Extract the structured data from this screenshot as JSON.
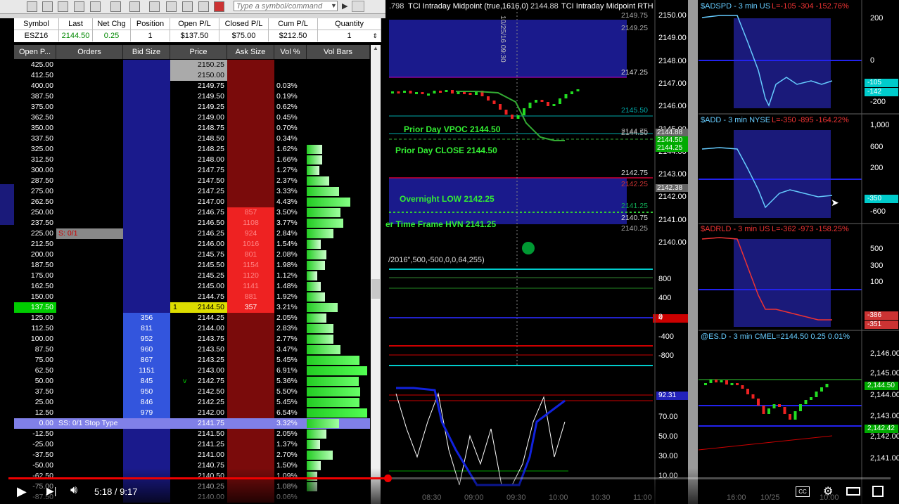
{
  "toolbar": {
    "symbol_placeholder": "Type a symbol/command"
  },
  "info": {
    "headers": [
      "Symbol",
      "Last",
      "Net Chg",
      "Position",
      "Open P/L",
      "Closed P/L",
      "Cum P/L",
      "Quantity"
    ],
    "values": [
      "ESZ16",
      "2144.50",
      "0.25",
      "1",
      "$137.50",
      "$75.00",
      "$212.50",
      "1"
    ]
  },
  "ladder": {
    "headers": [
      "Open P...",
      "Orders",
      "Bid Size",
      "Price",
      "Ask Size",
      "Vol %",
      "Vol Bars"
    ],
    "rows": [
      {
        "pl": "425.00",
        "ord": "",
        "bid": "",
        "price": "2150.25",
        "ask": "",
        "vol": "",
        "vb": 0
      },
      {
        "pl": "412.50",
        "ord": "",
        "bid": "",
        "price": "2150.00",
        "ask": "",
        "vol": "",
        "vb": 0
      },
      {
        "pl": "400.00",
        "ord": "",
        "bid": "",
        "price": "2149.75",
        "ask": "",
        "vol": "0.03%",
        "vb": 0
      },
      {
        "pl": "387.50",
        "ord": "",
        "bid": "",
        "price": "2149.50",
        "ask": "",
        "vol": "0.19%",
        "vb": 0
      },
      {
        "pl": "375.00",
        "ord": "",
        "bid": "",
        "price": "2149.25",
        "ask": "",
        "vol": "0.62%",
        "vb": 0
      },
      {
        "pl": "362.50",
        "ord": "",
        "bid": "",
        "price": "2149.00",
        "ask": "",
        "vol": "0.45%",
        "vb": 0
      },
      {
        "pl": "350.00",
        "ord": "",
        "bid": "",
        "price": "2148.75",
        "ask": "",
        "vol": "0.70%",
        "vb": 0
      },
      {
        "pl": "337.50",
        "ord": "",
        "bid": "",
        "price": "2148.50",
        "ask": "",
        "vol": "0.34%",
        "vb": 0
      },
      {
        "pl": "325.00",
        "ord": "",
        "bid": "",
        "price": "2148.25",
        "ask": "",
        "vol": "1.62%",
        "vb": 22
      },
      {
        "pl": "312.50",
        "ord": "",
        "bid": "",
        "price": "2148.00",
        "ask": "",
        "vol": "1.66%",
        "vb": 22
      },
      {
        "pl": "300.00",
        "ord": "",
        "bid": "",
        "price": "2147.75",
        "ask": "",
        "vol": "1.27%",
        "vb": 18
      },
      {
        "pl": "287.50",
        "ord": "",
        "bid": "",
        "price": "2147.50",
        "ask": "",
        "vol": "2.37%",
        "vb": 32
      },
      {
        "pl": "275.00",
        "ord": "",
        "bid": "",
        "price": "2147.25",
        "ask": "",
        "vol": "3.33%",
        "vb": 46
      },
      {
        "pl": "262.50",
        "ord": "",
        "bid": "",
        "price": "2147.00",
        "ask": "",
        "vol": "4.43%",
        "vb": 62
      },
      {
        "pl": "250.00",
        "ord": "",
        "bid": "",
        "price": "2146.75",
        "ask": "857",
        "vol": "3.50%",
        "vb": 48
      },
      {
        "pl": "237.50",
        "ord": "",
        "bid": "",
        "price": "2146.50",
        "ask": "1108",
        "vol": "3.77%",
        "vb": 52
      },
      {
        "pl": "225.00",
        "ord": "S: 0/1",
        "bid": "",
        "price": "2146.25",
        "ask": "924",
        "vol": "2.84%",
        "vb": 38
      },
      {
        "pl": "212.50",
        "ord": "",
        "bid": "",
        "price": "2146.00",
        "ask": "1016",
        "vol": "1.54%",
        "vb": 20
      },
      {
        "pl": "200.00",
        "ord": "",
        "bid": "",
        "price": "2145.75",
        "ask": "801",
        "vol": "2.08%",
        "vb": 28
      },
      {
        "pl": "187.50",
        "ord": "",
        "bid": "",
        "price": "2145.50",
        "ask": "1154",
        "vol": "1.98%",
        "vb": 26
      },
      {
        "pl": "175.00",
        "ord": "",
        "bid": "",
        "price": "2145.25",
        "ask": "1120",
        "vol": "1.12%",
        "vb": 15
      },
      {
        "pl": "162.50",
        "ord": "",
        "bid": "",
        "price": "2145.00",
        "ask": "1141",
        "vol": "1.48%",
        "vb": 20
      },
      {
        "pl": "150.00",
        "ord": "",
        "bid": "",
        "price": "2144.75",
        "ask": "881",
        "vol": "1.92%",
        "vb": 26
      },
      {
        "pl": "137.50",
        "ord": "",
        "bid": "",
        "price": "2144.50",
        "ask": "357",
        "vol": "3.21%",
        "vb": 44,
        "current": true,
        "pos": "1"
      },
      {
        "pl": "125.00",
        "ord": "",
        "bid": "356",
        "price": "2144.25",
        "ask": "",
        "vol": "2.05%",
        "vb": 28
      },
      {
        "pl": "112.50",
        "ord": "",
        "bid": "811",
        "price": "2144.00",
        "ask": "",
        "vol": "2.83%",
        "vb": 38
      },
      {
        "pl": "100.00",
        "ord": "",
        "bid": "952",
        "price": "2143.75",
        "ask": "",
        "vol": "2.77%",
        "vb": 38
      },
      {
        "pl": "87.50",
        "ord": "",
        "bid": "960",
        "price": "2143.50",
        "ask": "",
        "vol": "3.47%",
        "vb": 48
      },
      {
        "pl": "75.00",
        "ord": "",
        "bid": "867",
        "price": "2143.25",
        "ask": "",
        "vol": "5.45%",
        "vb": 75
      },
      {
        "pl": "62.50",
        "ord": "",
        "bid": "1151",
        "price": "2143.00",
        "ask": "",
        "vol": "6.91%",
        "vb": 86
      },
      {
        "pl": "50.00",
        "ord": "",
        "bid": "845",
        "price": "2142.75",
        "ask": "",
        "vol": "5.36%",
        "vb": 74,
        "vmark": "v"
      },
      {
        "pl": "37.50",
        "ord": "",
        "bid": "950",
        "price": "2142.50",
        "ask": "",
        "vol": "5.50%",
        "vb": 76
      },
      {
        "pl": "25.00",
        "ord": "",
        "bid": "846",
        "price": "2142.25",
        "ask": "",
        "vol": "5.45%",
        "vb": 75
      },
      {
        "pl": "12.50",
        "ord": "",
        "bid": "979",
        "price": "2142.00",
        "ask": "",
        "vol": "6.54%",
        "vb": 86
      },
      {
        "pl": "0.00",
        "ord": "SS: 0/1 Stop Type",
        "bid": "",
        "price": "2141.75",
        "ask": "",
        "vol": "3.32%",
        "vb": 46,
        "stop": true
      },
      {
        "pl": "-12.50",
        "ord": "",
        "bid": "",
        "price": "2141.50",
        "ask": "",
        "vol": "2.05%",
        "vb": 28
      },
      {
        "pl": "-25.00",
        "ord": "",
        "bid": "",
        "price": "2141.25",
        "ask": "",
        "vol": "1.37%",
        "vb": 19
      },
      {
        "pl": "-37.50",
        "ord": "",
        "bid": "",
        "price": "2141.00",
        "ask": "",
        "vol": "2.70%",
        "vb": 37
      },
      {
        "pl": "-50.00",
        "ord": "",
        "bid": "",
        "price": "2140.75",
        "ask": "",
        "vol": "1.50%",
        "vb": 20
      },
      {
        "pl": "-62.50",
        "ord": "",
        "bid": "",
        "price": "2140.50",
        "ask": "",
        "vol": "1.09%",
        "vb": 15
      },
      {
        "pl": "-75.00",
        "ord": "",
        "bid": "",
        "price": "2140.25",
        "ask": "",
        "vol": "1.08%",
        "vb": 15
      },
      {
        "pl": "-87.50",
        "ord": "",
        "bid": "",
        "price": "2140.00",
        "ask": "",
        "vol": "0.06%",
        "vb": 0
      }
    ]
  },
  "main_chart": {
    "title_left": ".798",
    "title": "TCI Intraday Midpoint (true,1616,0)",
    "last": "2144.88",
    "title_right": "TCI Intraday Midpoint RTH",
    "labels": {
      "vpoc": "Prior Day VPOC 2144.50",
      "close": "Prior Day CLOSE 2144.50",
      "overnight": "Overnight LOW 2142.25",
      "hvn": "er Time Frame HVN 2141.25",
      "date_marker": "10/25/16 09:30"
    },
    "level_labels": [
      "2149.75",
      "2149.25",
      "2147.25",
      "2145.50",
      "2144.75",
      "2144.50",
      "2142.75",
      "2142.25",
      "2141.25",
      "2140.75",
      "2140.25"
    ],
    "y_axis": [
      "2150.00",
      "2149.00",
      "2148.00",
      "2147.00",
      "2146.00",
      "2145.00",
      "2144.00",
      "2143.00",
      "2142.00",
      "2141.00",
      "2140.00"
    ],
    "y_markers": [
      "2144.88",
      "2144.50",
      "2144.25",
      "2142.38"
    ],
    "sub_title": "/2016\",500,-500,0,0,64,255)",
    "sub_axis": [
      "800",
      "400",
      "0",
      "-400",
      "-800"
    ],
    "sub_marker": "4",
    "osc_axis": [
      "70.00",
      "50.00",
      "30.00",
      "10.00"
    ],
    "osc_marker": "92.31",
    "x_axis": [
      "08:30",
      "09:00",
      "09:30",
      "10:00",
      "10:30",
      "11:00"
    ]
  },
  "right_panels": {
    "adspd": {
      "title": "$ADSPD - 3 min  US",
      "stats": "L=-105  -304  -152.76%",
      "axis": [
        "200",
        "0",
        "-200"
      ],
      "markers": [
        "-105",
        "-142"
      ]
    },
    "add": {
      "title": "$ADD - 3 min  NYSE",
      "stats": "L=-350  -895  -164.22%",
      "axis": [
        "1,000",
        "600",
        "200",
        "-600"
      ],
      "markers": [
        "-350"
      ]
    },
    "adrld": {
      "title": "$ADRLD - 3 min  US",
      "stats": "L=-362  -973  -158.25%",
      "axis": [
        "500",
        "300",
        "100"
      ],
      "markers": [
        "-386",
        "-351"
      ]
    },
    "es": {
      "title": "@ES.D - 3 min  CME",
      "stats": "L=2144.50  0.25   0.01%",
      "axis": [
        "2,146.00",
        "2,145.00",
        "2,144.00",
        "2,143.00",
        "2,142.00",
        "2,141.00"
      ],
      "markers": [
        "2,144.50",
        "2,142.42"
      ]
    },
    "x_axis": [
      "16:00",
      "10/25",
      "10:00"
    ]
  },
  "video": {
    "time": "5:18 / 9:17"
  }
}
